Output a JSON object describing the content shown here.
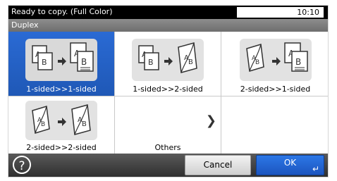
{
  "status": {
    "message": "Ready to copy. (Full Color)",
    "time": "10:10"
  },
  "screen": {
    "title": "Duplex"
  },
  "options": [
    {
      "label": "1-sided>>1-sided",
      "icon": "1-sided-to-1-sided-icon",
      "selected": true
    },
    {
      "label": "1-sided>>2-sided",
      "icon": "1-sided-to-2-sided-icon",
      "selected": false
    },
    {
      "label": "2-sided>>1-sided",
      "icon": "2-sided-to-1-sided-icon",
      "selected": false
    },
    {
      "label": "2-sided>>2-sided",
      "icon": "2-sided-to-2-sided-icon",
      "selected": false
    }
  ],
  "others": {
    "label": "Others"
  },
  "buttons": {
    "help": "?",
    "cancel": "Cancel",
    "ok": "OK"
  },
  "colors": {
    "selected_tile": "#2060c8",
    "ok_button": "#2a70e0",
    "status_bar": "#000000",
    "title_bar": "#7a7a7a"
  }
}
